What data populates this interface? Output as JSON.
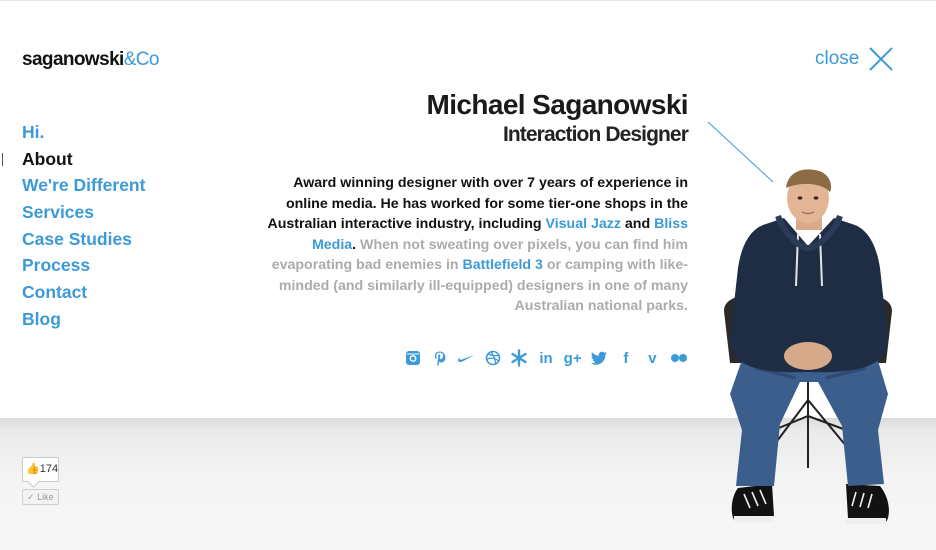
{
  "brand": {
    "logo_bold": "saganowski",
    "logo_light": "&Co"
  },
  "header": {
    "close_label": "close"
  },
  "nav": {
    "items": [
      {
        "label": "Hi."
      },
      {
        "label": "About",
        "active": true
      },
      {
        "label": "We're Different"
      },
      {
        "label": "Services"
      },
      {
        "label": "Case Studies"
      },
      {
        "label": "Process"
      },
      {
        "label": "Contact"
      },
      {
        "label": "Blog"
      }
    ]
  },
  "profile": {
    "name": "Michael Saganowski",
    "role": "Interaction Designer",
    "bio": {
      "p1": "Award winning designer with over 7 years of experience in online media. He has worked for some tier-one shops in the Australian interactive industry, including ",
      "link1": "Visual Jazz",
      "p2": " and ",
      "link2": "Bliss Media",
      "p3": ".",
      "p4": " When not sweating over pixels, you can find him evaporating bad enemies in ",
      "link3": "Battlefield 3",
      "p5": " or camping with like-minded (and similarly ill-equipped) designers in one of many Australian national parks."
    }
  },
  "social": {
    "icons": [
      "instagram-icon",
      "pinterest-icon",
      "nike-icon",
      "dribbble-icon",
      "snowflake-icon",
      "linkedin-icon",
      "google-plus-icon",
      "twitter-icon",
      "facebook-icon",
      "vimeo-icon",
      "flickr-icon"
    ],
    "linkedin_text": "in",
    "gplus_text": "g+",
    "facebook_text": "f",
    "vimeo_text": "v"
  },
  "facebook_like": {
    "count": "174",
    "button_label": "Like"
  },
  "colors": {
    "accent": "#3d9ad8",
    "text": "#111111",
    "muted": "#ababab"
  }
}
